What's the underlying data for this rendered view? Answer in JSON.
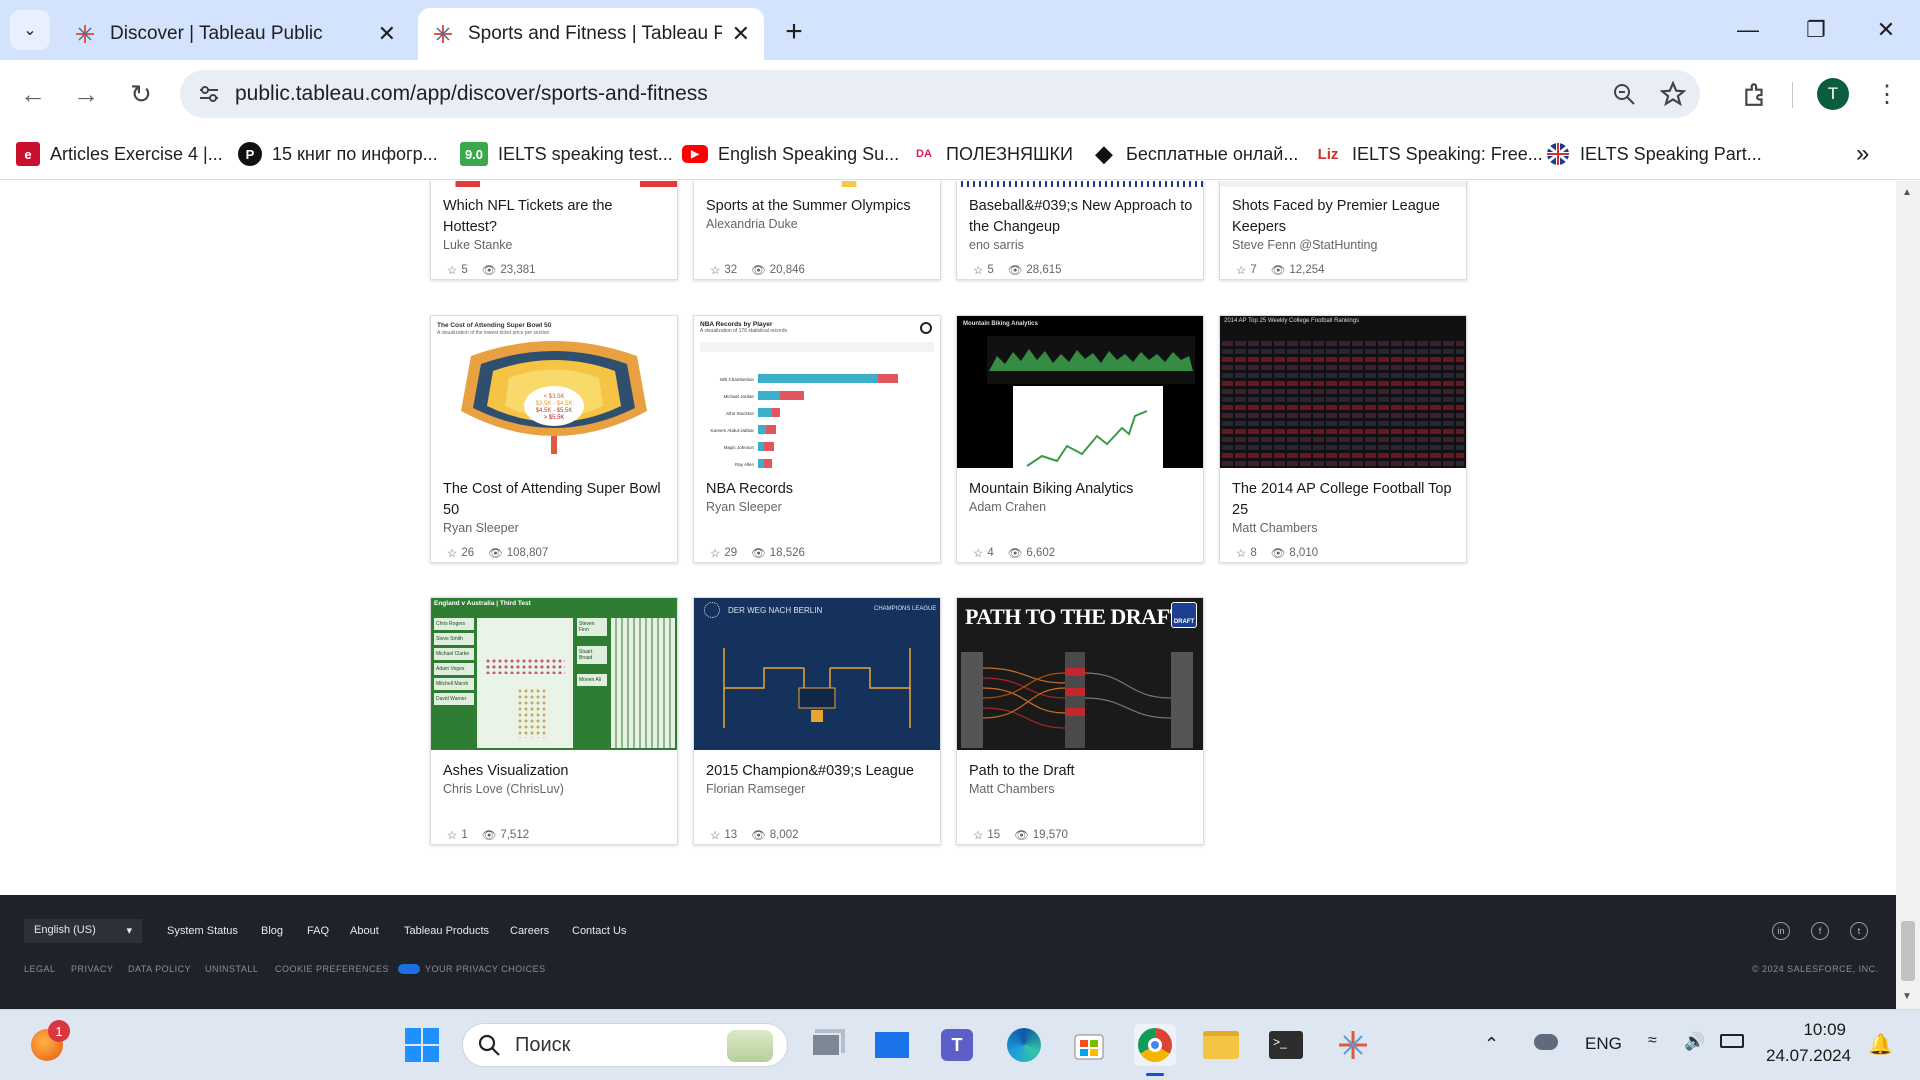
{
  "browser": {
    "tabs": [
      {
        "title": "Discover | Tableau Public",
        "active": false
      },
      {
        "title": "Sports and Fitness | Tableau Public",
        "active": true
      }
    ],
    "url": "public.tableau.com/app/discover/sports-and-fitness",
    "profile_initial": "T",
    "bookmarks": [
      {
        "label": "Articles Exercise 4 |...",
        "icon": "e-icon"
      },
      {
        "label": "15 книг по инфогр...",
        "icon": "p-icon"
      },
      {
        "label": "IELTS speaking test...",
        "icon": "9.0-icon"
      },
      {
        "label": "English Speaking Su...",
        "icon": "youtube-icon"
      },
      {
        "label": "ПОЛЕЗНЯШКИ",
        "icon": "data-icon"
      },
      {
        "label": "Бесплатные онлай...",
        "icon": "diamond-icon"
      },
      {
        "label": "IELTS Speaking: Free...",
        "icon": "liz-icon"
      },
      {
        "label": "IELTS Speaking Part...",
        "icon": "uk-flag-icon"
      }
    ]
  },
  "viz_rows": [
    [
      {
        "title": "Which NFL Tickets are the Hottest?",
        "author": "Luke Stanke",
        "favorites": "5",
        "views": "23,381"
      },
      {
        "title": "Sports at the Summer Olympics",
        "author": "Alexandria Duke",
        "favorites": "32",
        "views": "20,846"
      },
      {
        "title": "Baseball&#039;s New Approach to the Changeup",
        "author": "eno sarris",
        "favorites": "5",
        "views": "28,615"
      },
      {
        "title": "Shots Faced by Premier League Keepers",
        "author": "Steve Fenn @StatHunting",
        "favorites": "7",
        "views": "12,254"
      }
    ],
    [
      {
        "title": "The Cost of Attending Super Bowl 50",
        "author": "Ryan Sleeper",
        "favorites": "26",
        "views": "108,807",
        "thumb": {
          "heading": "The Cost of Attending Super Bowl 50",
          "sub": "A visualization of the lowest ticket price per section",
          "l1": "< $3.5K",
          "l2": "$3.5K - $4.5K",
          "l3": "$4.5K - $5.5K",
          "l4": "> $5.5K"
        }
      },
      {
        "title": "NBA Records",
        "author": "Ryan Sleeper",
        "favorites": "29",
        "views": "18,526",
        "thumb": {
          "heading": "NBA Records by Player",
          "sub": "A visualization of 176 statistical records",
          "players": [
            "Wilt Chamberlain",
            "Michael Jordan",
            "John Stockton",
            "Kareem Abdul-Jabbar",
            "Magic Johnson",
            "Ray Allen"
          ]
        }
      },
      {
        "title": "Mountain Biking Analytics",
        "author": "Adam Crahen",
        "favorites": "4",
        "views": "6,602",
        "thumb": {
          "heading": "Mountain Biking Analytics"
        }
      },
      {
        "title": "The 2014 AP College Football Top 25",
        "author": "Matt Chambers",
        "favorites": "8",
        "views": "8,010",
        "thumb": {
          "heading": "2014 AP Top 25 Weekly College Football Rankings"
        }
      }
    ],
    [
      {
        "title": "Ashes Visualization",
        "author": "Chris Love (ChrisLuv)",
        "favorites": "1",
        "views": "7,512",
        "thumb": {
          "heading": "England v Australia | Third Test",
          "players": [
            "Chris Rogers",
            "Steve Smith",
            "Michael Clarke",
            "Adam Voges",
            "Mitchell Marsh",
            "David Warner"
          ],
          "bowlers": [
            "Steven Finn",
            "Stuart Broad",
            "Moeen Ali"
          ]
        }
      },
      {
        "title": "2015 Champion&#039;s League",
        "author": "Florian Ramseger",
        "favorites": "13",
        "views": "8,002",
        "thumb": {
          "heading": "DER WEG NACH BERLIN",
          "brand": "CHAMPIONS LEAGUE"
        }
      },
      {
        "title": "Path to the Draft",
        "author": "Matt Chambers",
        "favorites": "15",
        "views": "19,570",
        "thumb": {
          "heading": "PATH TO THE DRAFT",
          "badge": "DRAFT"
        }
      }
    ]
  ],
  "footer": {
    "language": "English (US)",
    "links": [
      "System Status",
      "Blog",
      "FAQ",
      "About",
      "Tableau Products",
      "Careers",
      "Contact Us"
    ],
    "legal": [
      "LEGAL",
      "PRIVACY",
      "DATA POLICY",
      "UNINSTALL",
      "COOKIE PREFERENCES",
      "YOUR PRIVACY CHOICES"
    ],
    "copyright": "© 2024 SALESFORCE, INC."
  },
  "taskbar": {
    "search_placeholder": "Поиск",
    "notification_count": "1",
    "language": "ENG",
    "time": "10:09",
    "date": "24.07.2024"
  },
  "colors": {
    "titlebar": "#d3e3fd",
    "footer": "#1f2229",
    "taskbar": "#dde6f1",
    "accent": "#0b57d0"
  }
}
